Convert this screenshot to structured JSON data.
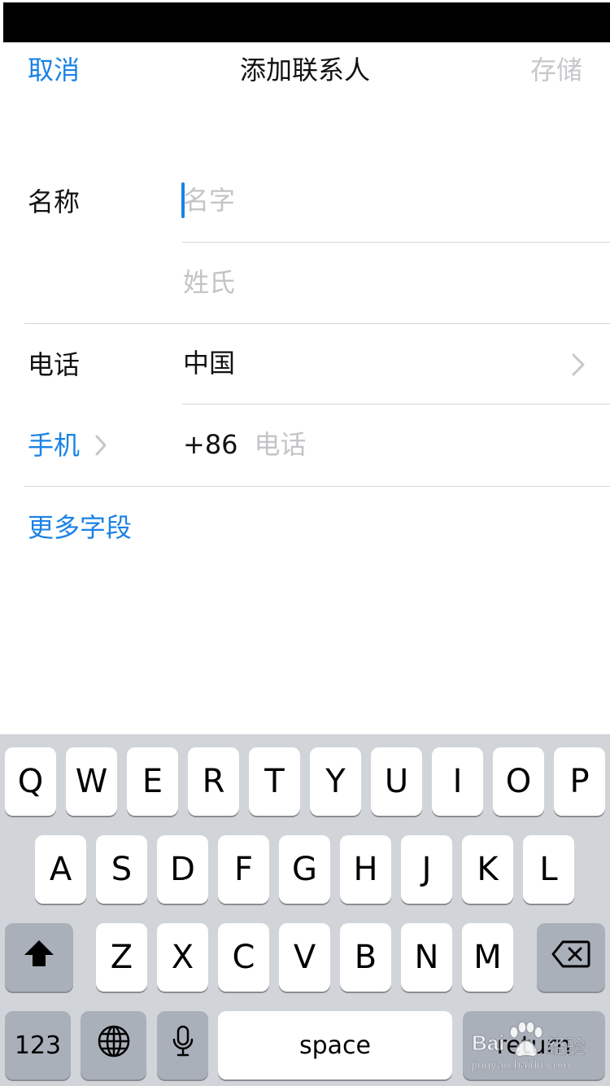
{
  "nav": {
    "cancel": "取消",
    "title": "添加联系人",
    "save": "存储"
  },
  "name_section": {
    "label": "名称",
    "first_placeholder": "名字",
    "last_placeholder": "姓氏"
  },
  "phone_section": {
    "label": "电话",
    "country": "中国",
    "type_label": "手机",
    "code": "+86",
    "phone_placeholder": "电话"
  },
  "more_fields": "更多字段",
  "keyboard": {
    "row1": [
      "Q",
      "W",
      "E",
      "R",
      "T",
      "Y",
      "U",
      "I",
      "O",
      "P"
    ],
    "row2": [
      "A",
      "S",
      "D",
      "F",
      "G",
      "H",
      "J",
      "K",
      "L"
    ],
    "row3": [
      "Z",
      "X",
      "C",
      "V",
      "B",
      "N",
      "M"
    ],
    "numbers_label": "123",
    "space_label": "space",
    "return_label": "return"
  },
  "watermark": {
    "brand": "Bai",
    "brand_cn": "经验",
    "url": "jingyan.baidu.com"
  },
  "colors": {
    "accent": "#1a82e6",
    "disabled": "#c7c7cc",
    "placeholder": "#c4c4c8",
    "keyboard_bg": "#d1d4d9",
    "key_dark": "#aab0ba"
  }
}
